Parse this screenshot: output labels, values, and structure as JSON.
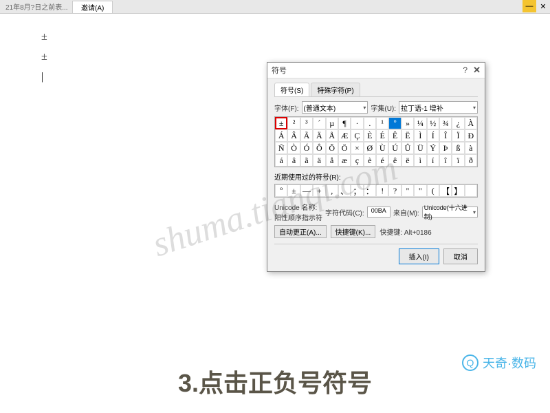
{
  "topbar": {
    "left_text": "21年8月?日之前表...",
    "tab": "邀请(A)"
  },
  "doc": {
    "line1": "±",
    "line2": "±"
  },
  "dialog": {
    "title": "符号",
    "tabs": {
      "symbols": "符号(S)",
      "special": "特殊字符(P)"
    },
    "font_label": "字体(F):",
    "font_value": "(普通文本)",
    "subset_label": "字集(U):",
    "subset_value": "拉丁语-1 增补",
    "grid": [
      [
        "±",
        "²",
        "³",
        "´",
        "µ",
        "¶",
        "·",
        ".",
        "¹",
        "º",
        "»",
        "¼",
        "½",
        "¾",
        "¿",
        "À"
      ],
      [
        "Á",
        "Â",
        "Ã",
        "Ä",
        "Å",
        "Æ",
        "Ç",
        "È",
        "É",
        "Ê",
        "Ë",
        "Ì",
        "Í",
        "Î",
        "Ï",
        "Ð"
      ],
      [
        "Ñ",
        "Ò",
        "Ó",
        "Ô",
        "Õ",
        "Ö",
        "×",
        "Ø",
        "Ù",
        "Ú",
        "Û",
        "Ü",
        "Ý",
        "Þ",
        "ß",
        "à"
      ],
      [
        "á",
        "â",
        "ã",
        "ä",
        "å",
        "æ",
        "ç",
        "è",
        "é",
        "ê",
        "ë",
        "ì",
        "í",
        "î",
        "ï",
        "ð"
      ]
    ],
    "selected_index": 0,
    "highlighted_index": 9,
    "recent_label": "近期使用过的符号(R):",
    "recent": [
      "º",
      "±",
      "—",
      "+",
      ",",
      "、",
      "；",
      "：",
      "!",
      "?",
      "\"",
      "\"",
      "(",
      "【",
      "】",
      ""
    ],
    "unicode_name_label": "Unicode 名称:",
    "unicode_name_value": "阳性顺序指示符",
    "char_code_label": "字符代码(C):",
    "char_code_value": "00BA",
    "from_label": "来自(M):",
    "from_value": "Unicode(十六进制)",
    "autocorrect_btn": "自动更正(A)...",
    "shortcut_btn": "快捷键(K)...",
    "shortcut_text": "快捷键: Alt+0186",
    "insert_btn": "插入(I)",
    "cancel_btn": "取消"
  },
  "watermark": "shuma.tianqi.com",
  "logo_text": "天奇·数码",
  "caption": "3.点击正负号符号"
}
